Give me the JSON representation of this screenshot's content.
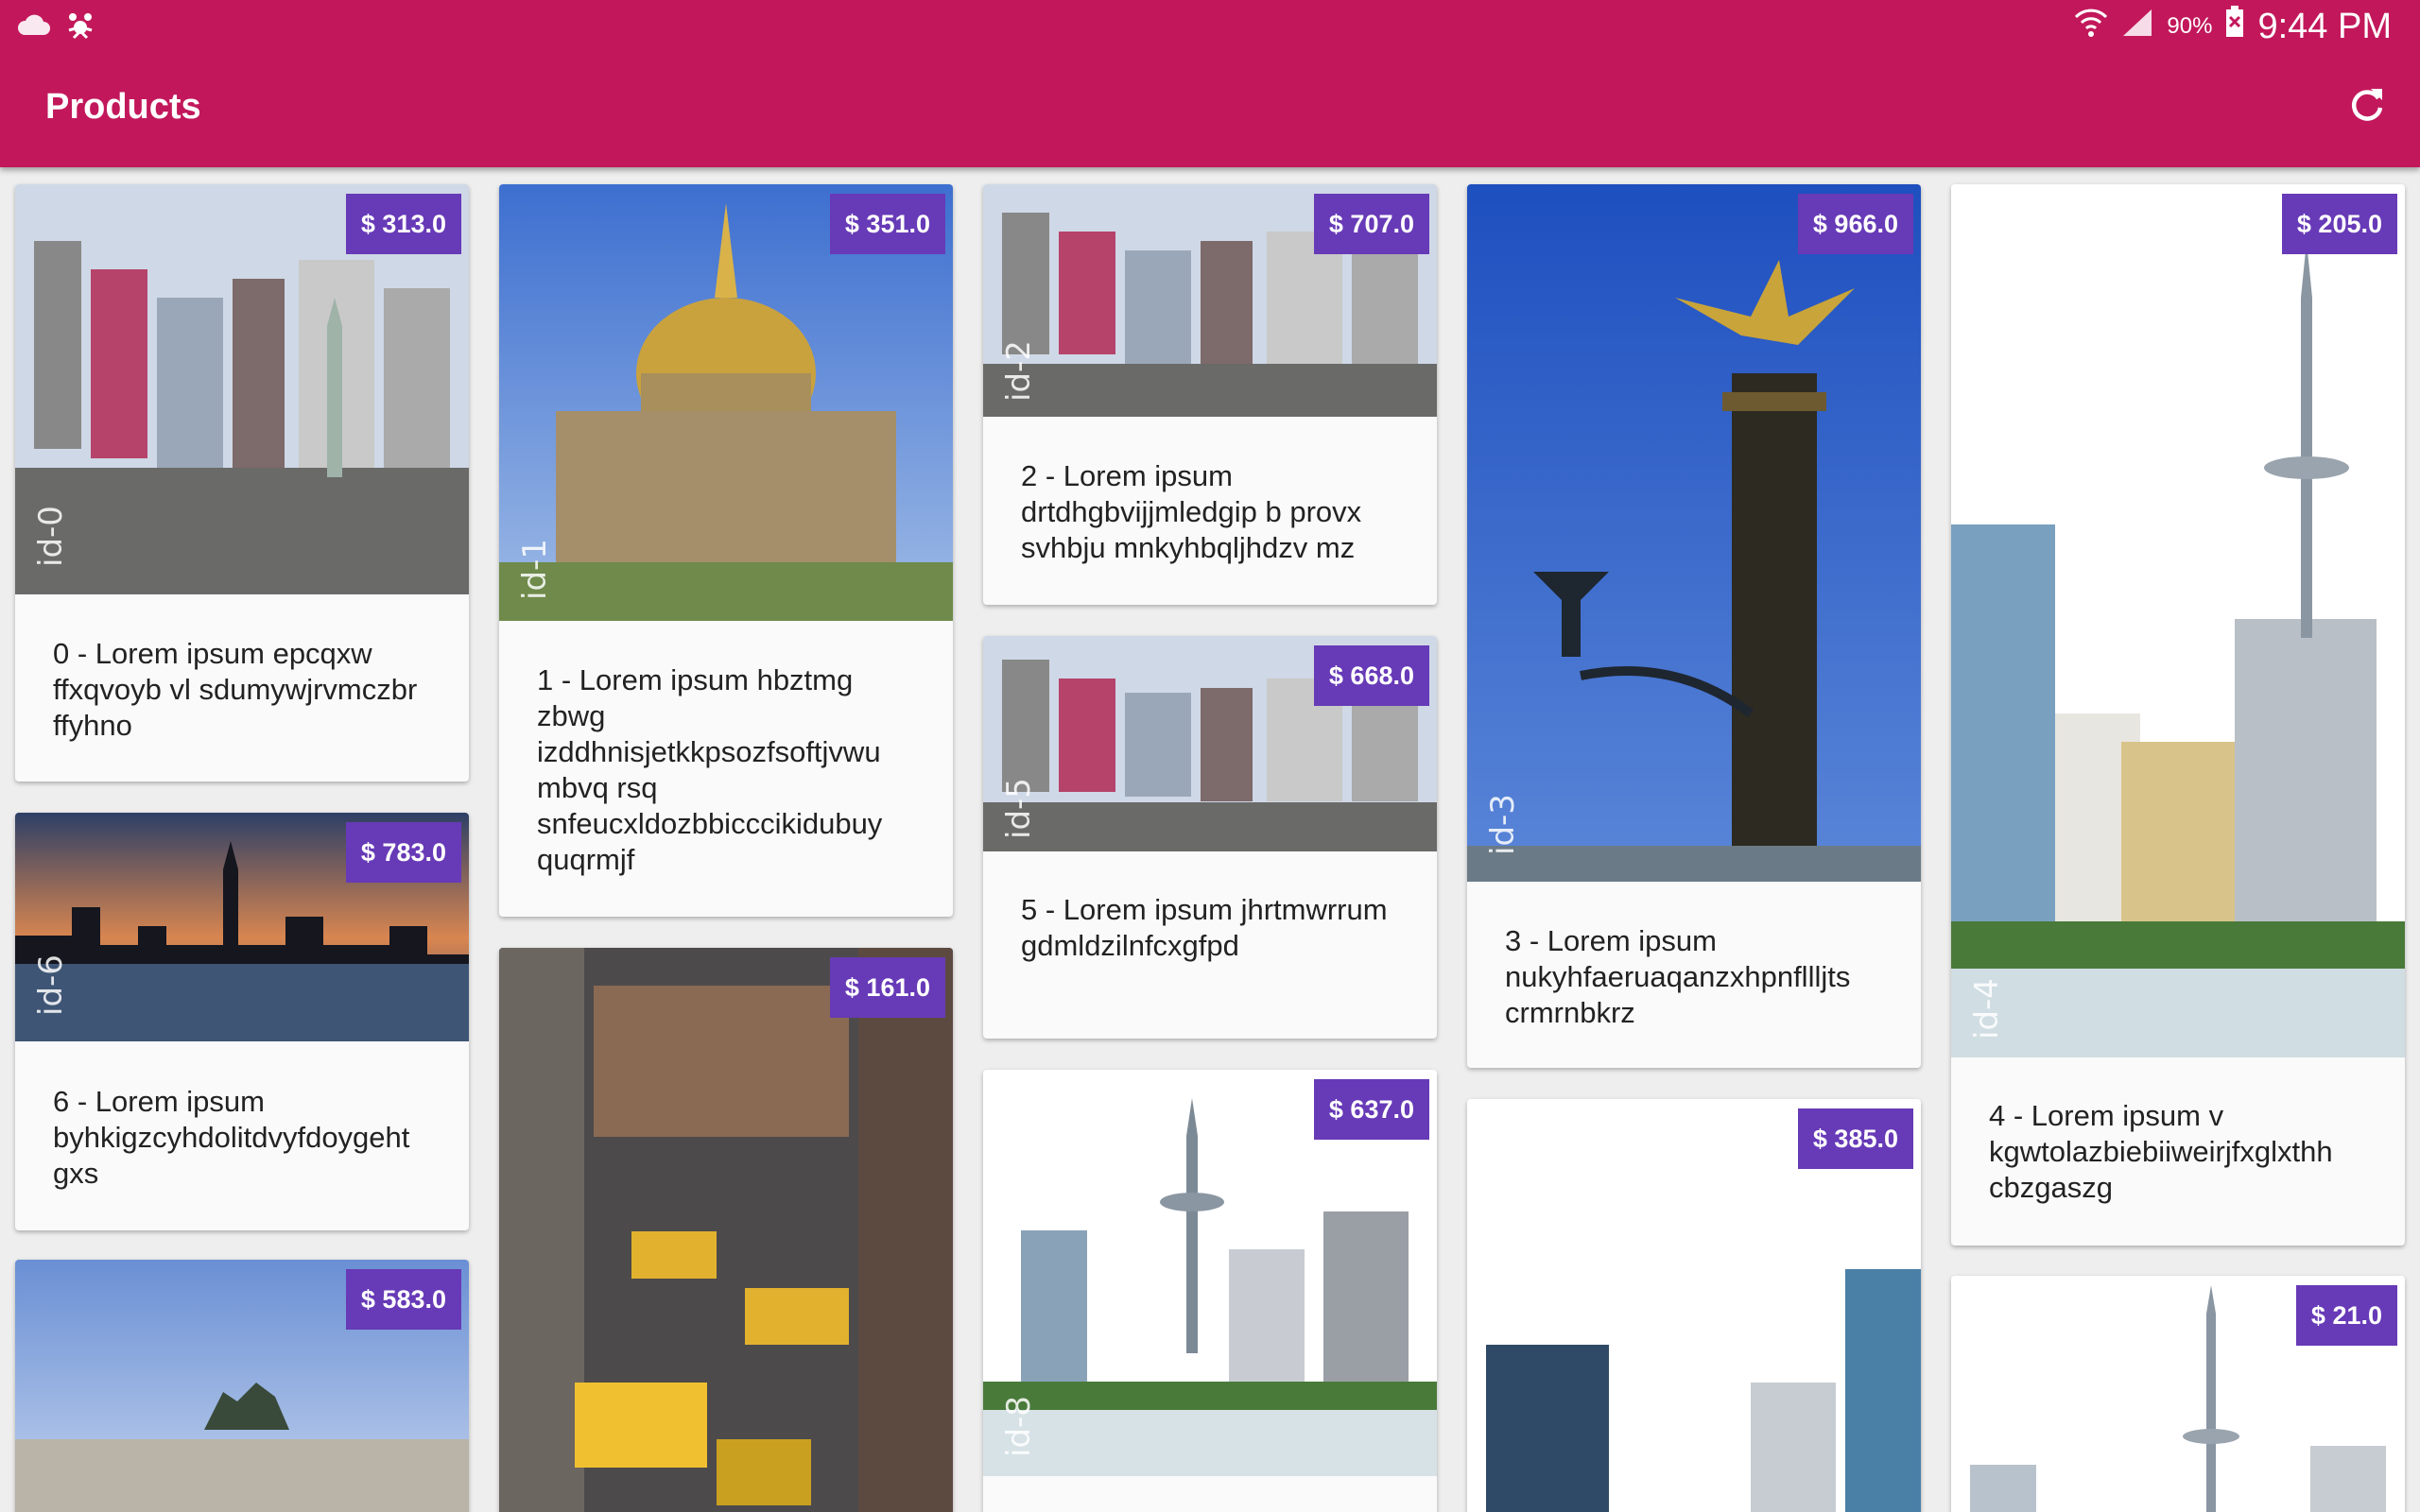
{
  "status_bar": {
    "battery": "90%",
    "time": "9:44 PM",
    "icons": [
      "cloud-icon",
      "bug-icon",
      "wifi-icon",
      "signal-icon",
      "battery-icon"
    ]
  },
  "app_bar": {
    "title": "Products",
    "refresh_icon": "refresh-icon"
  },
  "colors": {
    "app_bar": "#c2185b",
    "price_badge": "#673ab7",
    "card_background": "#fafafa",
    "page_background": "#eeeeee"
  },
  "products": [
    {
      "id_tag": "id-0",
      "price": "$ 313.0",
      "description": "0 - Lorem ipsum epcqxw ffxqvoyb  vl sdumywjrvmczbr ffyhno"
    },
    {
      "id_tag": "id-1",
      "price": "$ 351.0",
      "description": "1 - Lorem ipsum hbztmg zbwg izddhnisjetkkpsozfsoftjvwu mbvq rsq snfeucxldozbbicccikidubuy quqrmjf"
    },
    {
      "id_tag": "id-2",
      "price": "$ 707.0",
      "description": "2 - Lorem ipsum drtdhgbvijjmledgip b provx svhbju mnkyhbqljhdzv mz"
    },
    {
      "id_tag": "id-3",
      "price": "$ 966.0",
      "description": "3 - Lorem ipsum nukyhfaeruaqanzxhpnfllljts crmrnbkrz"
    },
    {
      "id_tag": "id-4",
      "price": "$ 205.0",
      "description": "4 - Lorem ipsum v kgwtolazbiebiiweirjfxglxthh cbzgaszg"
    },
    {
      "id_tag": "id-5",
      "price": "$ 668.0",
      "description": "5 - Lorem ipsum jhrtmwrrum gdmldzilnfcxgfpd"
    },
    {
      "id_tag": "id-6",
      "price": "$ 783.0",
      "description": "6 - Lorem ipsum byhkigzcyhdolitdvyfdoygeht gxs"
    },
    {
      "id_tag": "",
      "price": "$ 583.0",
      "description": ""
    },
    {
      "id_tag": "",
      "price": "$ 161.0",
      "description": ""
    },
    {
      "id_tag": "id-8",
      "price": "$ 637.0",
      "description": ""
    },
    {
      "id_tag": "",
      "price": "$ 385.0",
      "description": ""
    },
    {
      "id_tag": "",
      "price": "$ 21.0",
      "description": ""
    }
  ]
}
